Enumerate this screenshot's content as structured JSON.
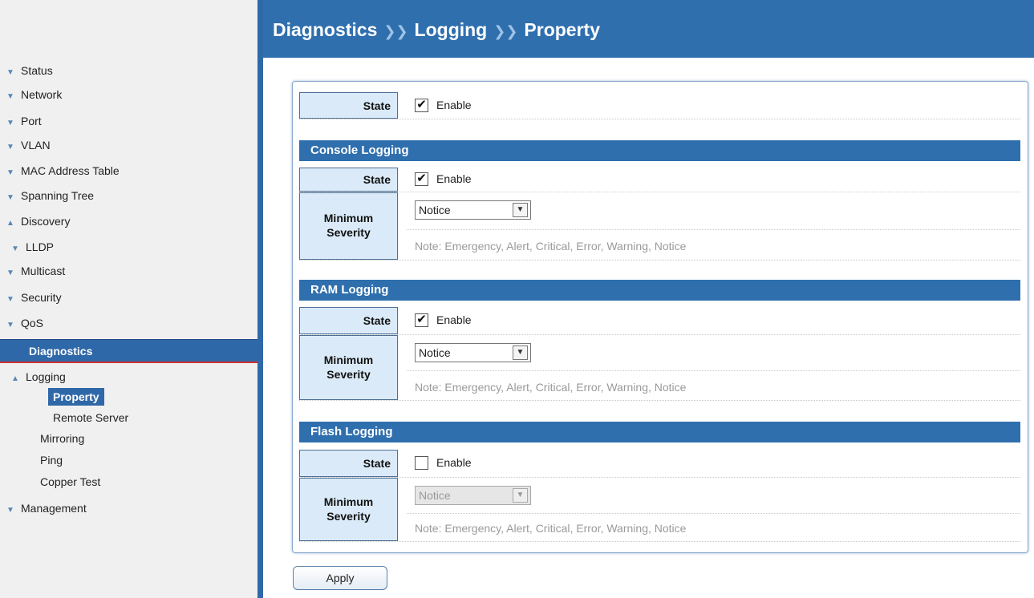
{
  "header": {
    "breadcrumb": [
      "Diagnostics",
      "Logging",
      "Property"
    ],
    "separator": "❯❯"
  },
  "sidebar": {
    "items": [
      {
        "label": "Status",
        "chevron": "chevron-down-icon"
      },
      {
        "label": "Network",
        "chevron": "chevron-down-icon"
      },
      {
        "label": "Port",
        "chevron": "chevron-down-icon"
      },
      {
        "label": "VLAN",
        "chevron": "chevron-down-icon"
      },
      {
        "label": "MAC Address Table",
        "chevron": "chevron-down-icon"
      },
      {
        "label": "Spanning Tree",
        "chevron": "chevron-down-icon"
      },
      {
        "label": "Discovery",
        "chevron": "chevron-up-icon"
      },
      {
        "label": "LLDP",
        "chevron": "chevron-down-icon"
      },
      {
        "label": "Multicast",
        "chevron": "chevron-down-icon"
      },
      {
        "label": "Security",
        "chevron": "chevron-down-icon"
      },
      {
        "label": "QoS",
        "chevron": "chevron-down-icon"
      }
    ],
    "selected_section": "Diagnostics",
    "logging": "Logging",
    "property": "Property",
    "remote_server": "Remote Server",
    "mirroring": "Mirroring",
    "ping": "Ping",
    "copper_test": "Copper Test",
    "management": "Management"
  },
  "main": {
    "state_label": "State",
    "enable_label": "Enable",
    "global_state_enabled": true,
    "min_label_line1": "Minimum",
    "min_label_line2": "Severity",
    "note": "Note: Emergency, Alert, Critical, Error, Warning, Notice",
    "console": {
      "title": "Console Logging",
      "enabled": true,
      "severity": "Notice"
    },
    "ram": {
      "title": "RAM Logging",
      "enabled": true,
      "severity": "Notice"
    },
    "flash": {
      "title": "Flash Logging",
      "enabled": false,
      "severity": "Notice"
    }
  },
  "apply_label": "Apply",
  "colors": {
    "header_bg": "#2f6fae",
    "label_bg": "#daeaf8",
    "selected_nav_bg": "#2f68a8"
  }
}
